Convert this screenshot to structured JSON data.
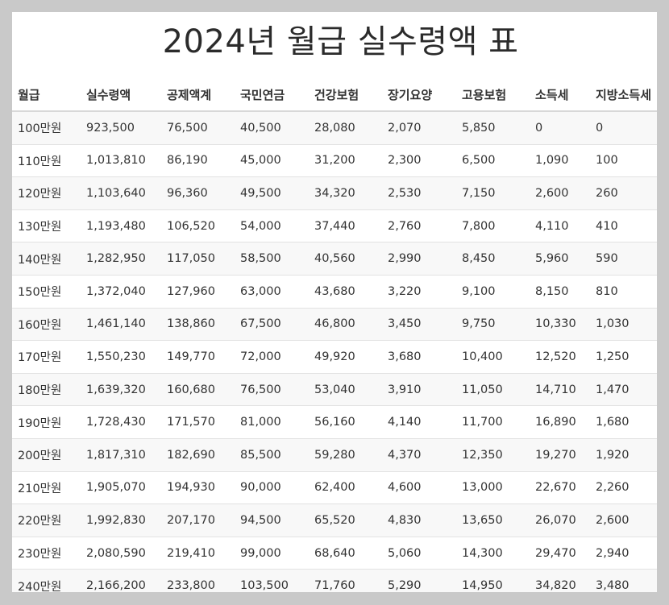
{
  "title": "2024년 월급 실수령액 표",
  "headers": [
    "월급",
    "실수령액",
    "공제액계",
    "국민연금",
    "건강보험",
    "장기요양",
    "고용보험",
    "소득세",
    "지방소득세"
  ],
  "rows": [
    [
      "100만원",
      "923,500",
      "76,500",
      "40,500",
      "28,080",
      "2,070",
      "5,850",
      "0",
      "0"
    ],
    [
      "110만원",
      "1,013,810",
      "86,190",
      "45,000",
      "31,200",
      "2,300",
      "6,500",
      "1,090",
      "100"
    ],
    [
      "120만원",
      "1,103,640",
      "96,360",
      "49,500",
      "34,320",
      "2,530",
      "7,150",
      "2,600",
      "260"
    ],
    [
      "130만원",
      "1,193,480",
      "106,520",
      "54,000",
      "37,440",
      "2,760",
      "7,800",
      "4,110",
      "410"
    ],
    [
      "140만원",
      "1,282,950",
      "117,050",
      "58,500",
      "40,560",
      "2,990",
      "8,450",
      "5,960",
      "590"
    ],
    [
      "150만원",
      "1,372,040",
      "127,960",
      "63,000",
      "43,680",
      "3,220",
      "9,100",
      "8,150",
      "810"
    ],
    [
      "160만원",
      "1,461,140",
      "138,860",
      "67,500",
      "46,800",
      "3,450",
      "9,750",
      "10,330",
      "1,030"
    ],
    [
      "170만원",
      "1,550,230",
      "149,770",
      "72,000",
      "49,920",
      "3,680",
      "10,400",
      "12,520",
      "1,250"
    ],
    [
      "180만원",
      "1,639,320",
      "160,680",
      "76,500",
      "53,040",
      "3,910",
      "11,050",
      "14,710",
      "1,470"
    ],
    [
      "190만원",
      "1,728,430",
      "171,570",
      "81,000",
      "56,160",
      "4,140",
      "11,700",
      "16,890",
      "1,680"
    ],
    [
      "200만원",
      "1,817,310",
      "182,690",
      "85,500",
      "59,280",
      "4,370",
      "12,350",
      "19,270",
      "1,920"
    ],
    [
      "210만원",
      "1,905,070",
      "194,930",
      "90,000",
      "62,400",
      "4,600",
      "13,000",
      "22,670",
      "2,260"
    ],
    [
      "220만원",
      "1,992,830",
      "207,170",
      "94,500",
      "65,520",
      "4,830",
      "13,650",
      "26,070",
      "2,600"
    ],
    [
      "230만원",
      "2,080,590",
      "219,410",
      "99,000",
      "68,640",
      "5,060",
      "14,300",
      "29,470",
      "2,940"
    ],
    [
      "240만원",
      "2,166,200",
      "233,800",
      "103,500",
      "71,760",
      "5,290",
      "14,950",
      "34,820",
      "3,480"
    ]
  ]
}
